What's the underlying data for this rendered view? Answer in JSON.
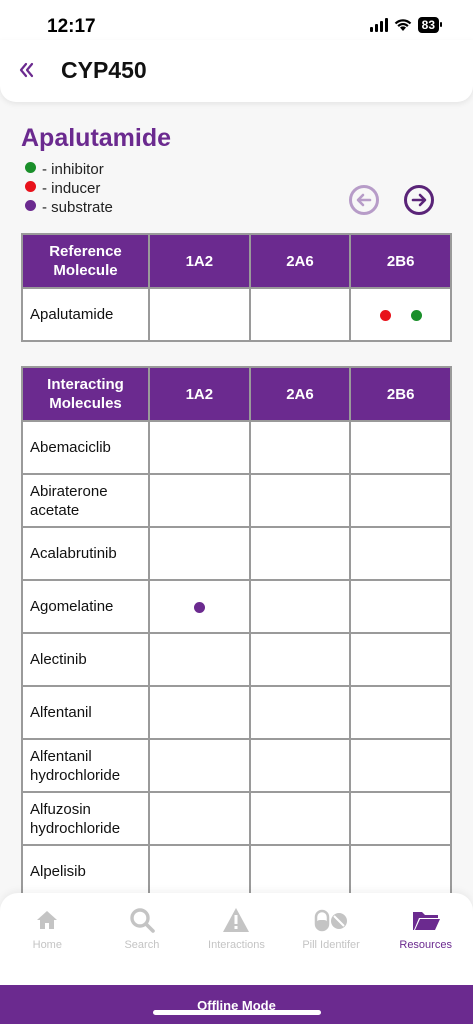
{
  "status_bar": {
    "time": "12:17",
    "battery": "83"
  },
  "header": {
    "back_icon": "double-chevron-left-icon",
    "title": "CYP450"
  },
  "drug": {
    "name": "Apalutamide",
    "legend": [
      {
        "label": "- inhibitor",
        "color": "#1a8f2a"
      },
      {
        "label": "- inducer",
        "color": "#e8121b"
      },
      {
        "label": "- substrate",
        "color": "#6b2a8f"
      }
    ]
  },
  "colors": {
    "inhibitor": "#1a8f2a",
    "inducer": "#e8121b",
    "substrate": "#6b2a8f",
    "accent": "#6b2a8f"
  },
  "pager": {
    "prev_icon": "arrow-left-circle-icon",
    "next_icon": "arrow-right-circle-icon"
  },
  "reference_table": {
    "header": [
      "Reference Molecule",
      "1A2",
      "2A6",
      "2B6"
    ],
    "rows": [
      {
        "name": "Apalutamide",
        "cells": [
          [],
          [],
          [
            "inducer",
            "inhibitor"
          ]
        ]
      }
    ]
  },
  "interacting_table": {
    "header": [
      "Interacting Molecules",
      "1A2",
      "2A6",
      "2B6"
    ],
    "rows": [
      {
        "name": "Abemaciclib",
        "cells": [
          [],
          [],
          []
        ]
      },
      {
        "name": "Abiraterone acetate",
        "cells": [
          [],
          [],
          []
        ]
      },
      {
        "name": "Acalabrutinib",
        "cells": [
          [],
          [],
          []
        ]
      },
      {
        "name": "Agomelatine",
        "cells": [
          [
            "substrate"
          ],
          [],
          []
        ]
      },
      {
        "name": "Alectinib",
        "cells": [
          [],
          [],
          []
        ]
      },
      {
        "name": "Alfentanil",
        "cells": [
          [],
          [],
          []
        ]
      },
      {
        "name": "Alfentanil hydrochloride",
        "cells": [
          [],
          [],
          []
        ]
      },
      {
        "name": "Alfuzosin hydrochloride",
        "cells": [
          [],
          [],
          []
        ]
      },
      {
        "name": "Alpelisib",
        "cells": [
          [],
          [],
          []
        ]
      }
    ]
  },
  "bottom_nav": [
    {
      "label": "Home",
      "icon": "home-icon",
      "active": false
    },
    {
      "label": "Search",
      "icon": "search-icon",
      "active": false
    },
    {
      "label": "Interactions",
      "icon": "warning-icon",
      "active": false
    },
    {
      "label": "Pill Identifer",
      "icon": "pill-icon",
      "active": false
    },
    {
      "label": "Resources",
      "icon": "folder-icon",
      "active": true
    }
  ],
  "offline_banner": "Offline Mode"
}
